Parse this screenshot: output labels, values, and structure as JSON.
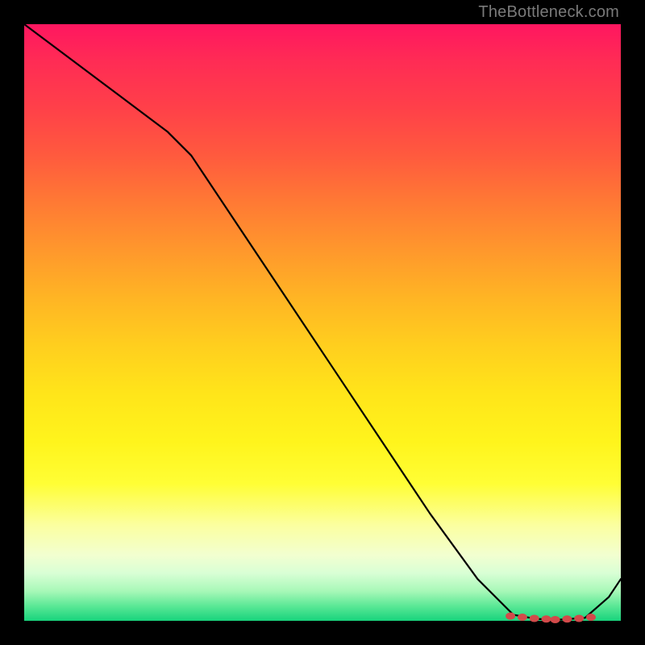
{
  "watermark": "TheBottleneck.com",
  "chart_data": {
    "type": "line",
    "title": "",
    "xlabel": "",
    "ylabel": "",
    "xlim": [
      0,
      100
    ],
    "ylim": [
      0,
      100
    ],
    "series": [
      {
        "name": "bottleneck-curve",
        "x": [
          0,
          8,
          16,
          24,
          28,
          36,
          44,
          52,
          60,
          68,
          76,
          82,
          86,
          90,
          94,
          98,
          100
        ],
        "values": [
          100,
          94,
          88,
          82,
          78,
          66,
          54,
          42,
          30,
          18,
          7,
          1,
          0.3,
          0.2,
          0.5,
          4,
          7
        ]
      }
    ],
    "markers": {
      "name": "plateau-markers",
      "x": [
        81.5,
        83.5,
        85.5,
        87.5,
        89,
        91,
        93,
        95
      ],
      "values": [
        0.8,
        0.6,
        0.4,
        0.3,
        0.2,
        0.3,
        0.4,
        0.6
      ]
    },
    "gradient_stops": [
      {
        "pos": 0,
        "color": "#ff1660"
      },
      {
        "pos": 0.5,
        "color": "#ffe51a"
      },
      {
        "pos": 0.88,
        "color": "#fbffa0"
      },
      {
        "pos": 1,
        "color": "#18d37c"
      }
    ]
  }
}
